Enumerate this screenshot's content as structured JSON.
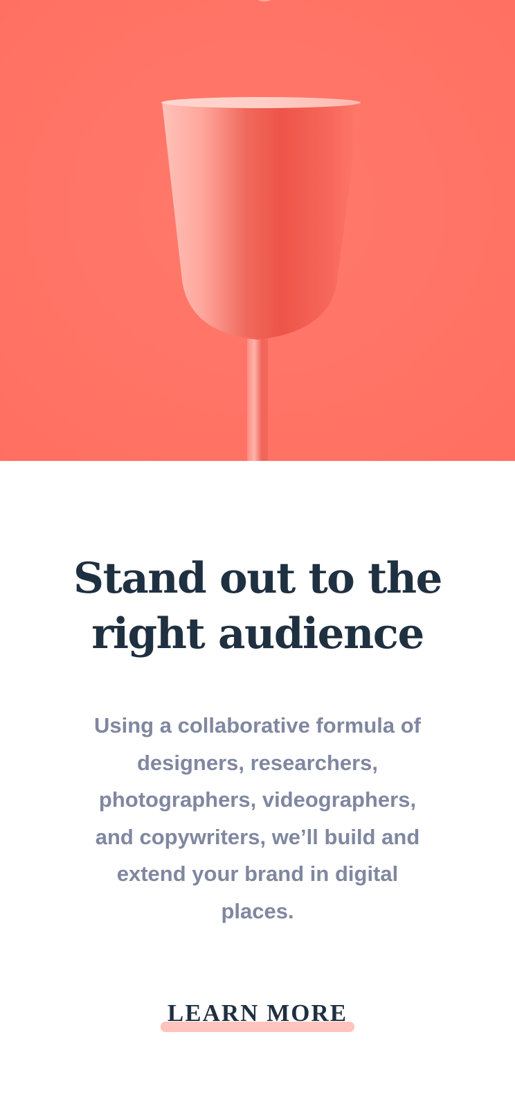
{
  "colors": {
    "hero_background": "#ff7466",
    "headline": "#1f3041",
    "body_text": "#8087a0",
    "cta_text": "#1f3041",
    "cta_underline": "#ffc4bd"
  },
  "hero": {
    "image": "coral-wine-glass-photo"
  },
  "main": {
    "headline": "Stand out to the right audience",
    "body": "Using a collaborative formula of designers, researchers, photographers, videographers, and copywriters, we’ll build and extend your brand in digital places.",
    "cta_label": "LEARN MORE"
  }
}
